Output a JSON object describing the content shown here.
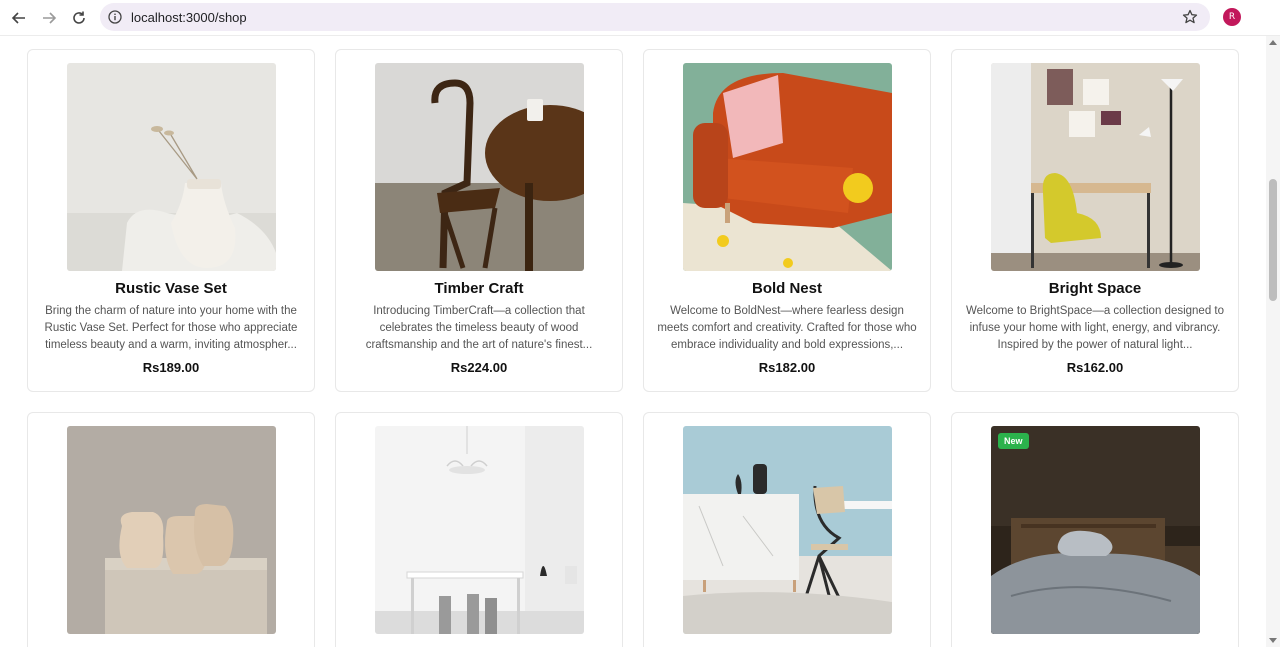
{
  "browser": {
    "url": "localhost:3000/shop",
    "profile_initial": "R"
  },
  "products": [
    {
      "name": "Rustic Vase Set",
      "description": "Bring the charm of nature into your home with the Rustic Vase Set. Perfect for those who appreciate timeless beauty and a warm, inviting atmospher...",
      "price": "Rs189.00"
    },
    {
      "name": "Timber Craft",
      "description": "Introducing TimberCraft—a collection that celebrates the timeless beauty of wood craftsmanship and the art of nature's finest...",
      "price": "Rs224.00"
    },
    {
      "name": "Bold Nest",
      "description": "Welcome to BoldNest—where fearless design meets comfort and creativity. Crafted for those who embrace individuality and bold expressions,...",
      "price": "Rs182.00"
    },
    {
      "name": "Bright Space",
      "description": "Welcome to BrightSpace—a collection designed to infuse your home with light, energy, and vibrancy. Inspired by the power of natural light...",
      "price": "Rs162.00"
    }
  ],
  "new_badge": "New",
  "colors": {
    "address_bar": "#f1ecf6",
    "badge": "#2bb24c",
    "profile": "#c2185b"
  }
}
